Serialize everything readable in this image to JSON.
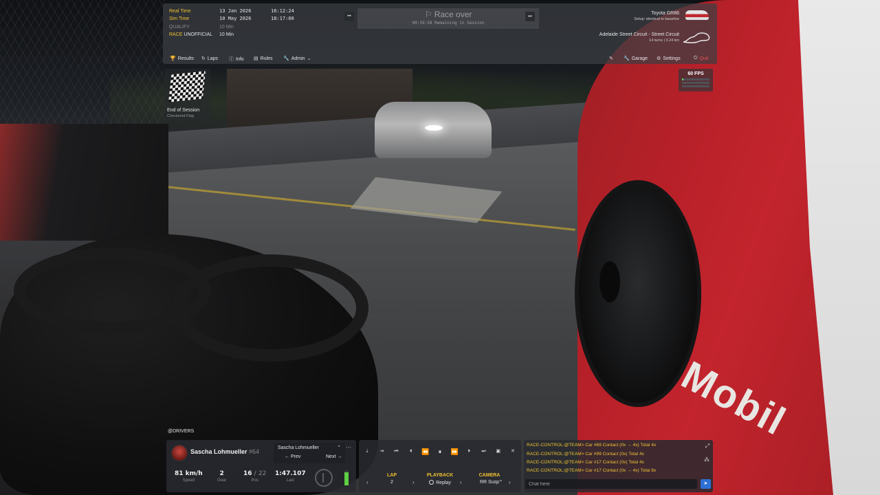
{
  "session": {
    "real_time_label": "Real Time",
    "real_time_date": "13 Jan 2026",
    "real_time_clock": "16:12:24",
    "sim_time_label": "Sim Time",
    "sim_time_date": "10 May 2026",
    "sim_time_clock": "18:17:00",
    "qualify_label": "QUALIFY",
    "qualify_duration": "10 Min",
    "race_label": "RACE",
    "race_status": "UNOFFICIAL",
    "race_duration": "10 Min",
    "title": "Race over",
    "remaining": "00:59:58 Remaining in Session"
  },
  "car": {
    "name": "Toyota GR86",
    "setup": "Setup: identical to baseline"
  },
  "track": {
    "name": "Adelaide Street Circuit - Street Circuit",
    "turns": "14 turns",
    "length": "3.24 km"
  },
  "menu": {
    "results": "Results",
    "laps": "Laps",
    "info": "Info",
    "rules": "Rules",
    "admin": "Admin",
    "garage": "Garage",
    "settings": "Settings",
    "quit": "Quit"
  },
  "flag": {
    "title": "End of Session",
    "subtitle": "Checkered Flag"
  },
  "fps": {
    "value": "60 FPS",
    "bar_levels": [
      0.05,
      0.0,
      0.0
    ]
  },
  "drivers_tag": "@DRIVERS",
  "driver": {
    "name": "Sascha Lohmueller",
    "number": "#64",
    "selector_name": "Sascha Lohmueller",
    "prev": "← Prev",
    "next": "Next →",
    "speed_value": "81 km/h",
    "speed_label": "Speed",
    "gear_value": "2",
    "gear_label": "Gear",
    "pos_value": "16",
    "pos_total": "22",
    "pos_sep": "/",
    "pos_label": "Pos",
    "last_value": "1:47.107",
    "last_label": "Last",
    "throttle": 0.85
  },
  "playback": {
    "lap_header": "LAP",
    "lap_value": "2",
    "playback_header": "PLAYBACK",
    "playback_value": "Replay",
    "camera_header": "CAMERA",
    "camera_value": "RR Susp"
  },
  "chat": {
    "lines": [
      {
        "source": "RACE-CONTROL:@TEAM>",
        "message": "Car #69 Contact (0x → 4x) Total 4x"
      },
      {
        "source": "RACE-CONTROL:@TEAM>",
        "message": "Car #99 Contact (0x) Total 4x"
      },
      {
        "source": "RACE-CONTROL:@TEAM>",
        "message": "Car #17 Contact (0x) Total 4x"
      },
      {
        "source": "RACE-CONTROL:@TEAM>",
        "message": "Car #17 Contact (0x → 4x) Total 8x"
      }
    ],
    "placeholder": "Chat here"
  },
  "colors": {
    "accent_yellow": "#f1c232",
    "quit_red": "#e55353",
    "send_blue": "#2d6fd6",
    "throttle_green": "#5fcf45"
  },
  "scene": {
    "car_decal": "Mobil"
  }
}
